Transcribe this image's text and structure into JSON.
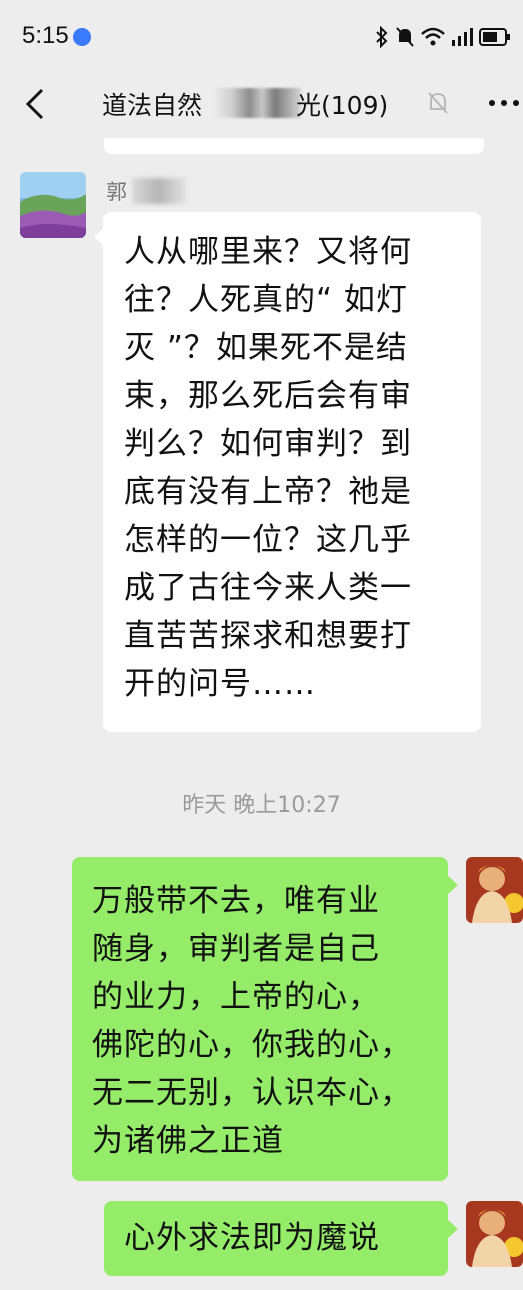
{
  "status_bar": {
    "time": "5:15"
  },
  "header": {
    "title_left": "道法自然",
    "title_right": "光(109)"
  },
  "messages": [
    {
      "sender": "郭",
      "side": "left",
      "lines": [
        "人从哪里来？又将何",
        "往？人死真的“ 如灯",
        "灭 ”？如果死不是结",
        "束，那么死后会有审",
        "判么？如何审判？到",
        "底有没有上帝？祂是",
        "怎样的一位？这几乎",
        "成了古往今来人类一",
        "直苦苦探求和想要打",
        "开的问号……"
      ]
    },
    {
      "side": "right",
      "lines": [
        "万般带不去，唯有业",
        "随身，审判者是自己",
        "的业力，上帝的心，",
        "佛陀的心，你我的心，",
        "无二无别，认识夲心，",
        "为诸佛之正道"
      ]
    },
    {
      "side": "right",
      "lines": [
        "心外求法即为魔说"
      ]
    }
  ],
  "timestamp": "昨天 晚上10:27",
  "colors": {
    "background": "#ededed",
    "bubble_self": "#95ec69",
    "bubble_other": "#ffffff",
    "timestamp": "#9a9a9a"
  },
  "icons": [
    "back-arrow-icon",
    "mute-bell-icon",
    "more-dots-icon",
    "bluetooth-icon",
    "silent-icon",
    "wifi-icon",
    "signal-icon",
    "battery-icon"
  ]
}
